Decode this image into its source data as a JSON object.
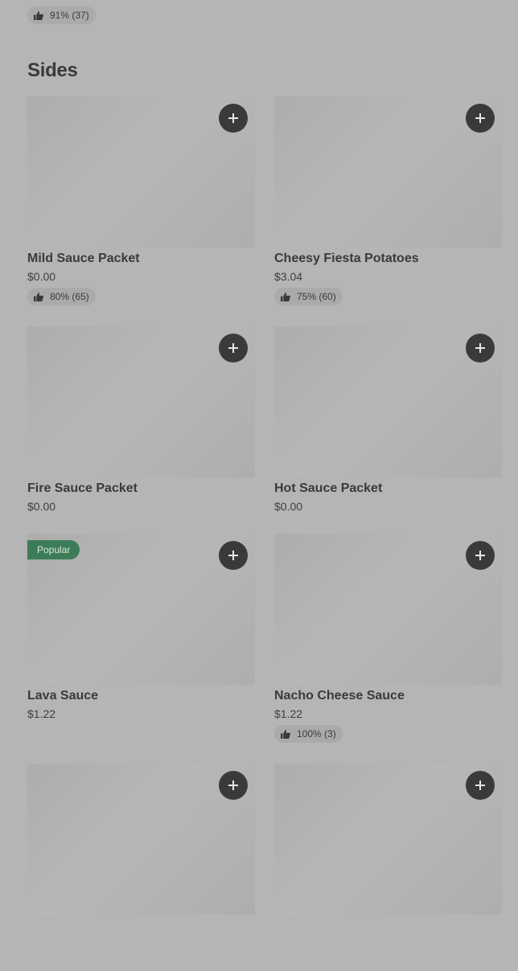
{
  "top_item": {
    "rating": "91% (37)"
  },
  "section": {
    "title": "Sides"
  },
  "items": [
    {
      "name": "Mild Sauce Packet",
      "price": "$0.00",
      "rating": "80% (65)"
    },
    {
      "name": "Cheesy Fiesta Potatoes",
      "price": "$3.04",
      "rating": "75% (60)"
    },
    {
      "name": "Fire Sauce Packet",
      "price": "$0.00"
    },
    {
      "name": "Hot Sauce Packet",
      "price": "$0.00"
    },
    {
      "name": "Lava Sauce",
      "price": "$1.22",
      "badge": "Popular"
    },
    {
      "name": "Nacho Cheese Sauce",
      "price": "$1.22",
      "rating": "100% (3)"
    },
    {},
    {}
  ],
  "icons": {
    "add": "plus-icon",
    "rating": "thumbs-up-icon"
  },
  "colors": {
    "background": "#b5b5b5",
    "button": "#3a3a3a",
    "badge": "#3c7c58"
  }
}
